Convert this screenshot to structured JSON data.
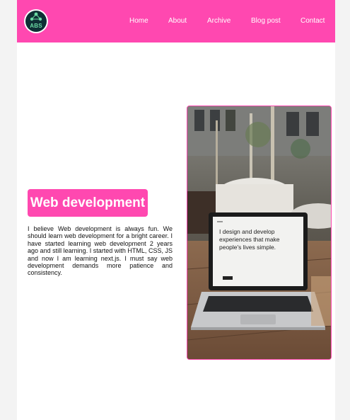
{
  "logo": {
    "text": "ABS",
    "icon": "network-nodes-icon"
  },
  "nav": {
    "home": "Home",
    "about": "About",
    "archive": "Archive",
    "blog_post": "Blog post",
    "contact": "Contact"
  },
  "article": {
    "title": "Web development",
    "body": "I believe Web development is always fun. We should learn web development for a bright career. I have started learning web development 2 years ago and still learning. I started with HTML, CSS, JS and now I am learning next.js. I must say web development demands more patience and consistency."
  },
  "image": {
    "screen_text_line1": "I design and develop",
    "screen_text_line2": "experiences that make",
    "screen_text_line3": "people's lives simple."
  },
  "colors": {
    "accent": "#ff48b0",
    "background": "#ffffff"
  }
}
